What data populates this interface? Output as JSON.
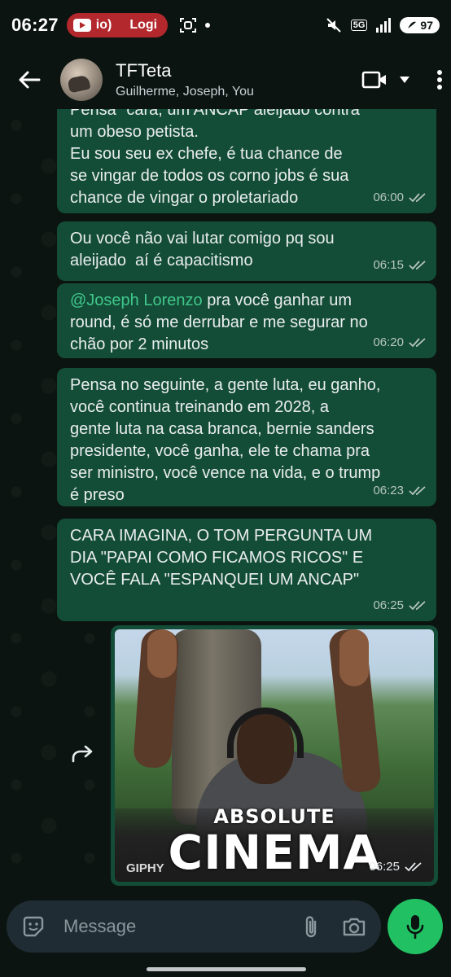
{
  "status_bar": {
    "time": "06:27",
    "media_label": "io)",
    "media_label2": "Logi",
    "network": "5G",
    "battery": "97"
  },
  "header": {
    "group_name": "TFTeta",
    "members": "Guilherme, Joseph, You"
  },
  "messages": [
    {
      "text": "Pensa \"cara, um ANCAP aleijado contra\num obeso petista.\nEu sou seu ex chefe, é tua chance de\nse vingar de todos os corno jobs é sua\nchance de vingar o proletariado",
      "time": "06:00"
    },
    {
      "text": "Ou você não vai lutar comigo pq sou\naleijado  aí é capacitismo",
      "time": "06:15"
    },
    {
      "mention": "@Joseph Lorenzo",
      "text": " pra você ganhar um\nround, é só me derrubar e me segurar no\nchão por 2 minutos",
      "time": "06:20"
    },
    {
      "text": "Pensa no seguinte, a gente luta, eu ganho,\nvocê continua treinando em 2028, a\ngente luta na casa branca, bernie sanders\npresidente, você ganha, ele te chama pra\nser ministro, você vence na vida, e o trump\né preso",
      "time": "06:23"
    },
    {
      "text": "CARA IMAGINA, O TOM PERGUNTA UM\nDIA \"PAPAI COMO FICAMOS RICOS\" E\nVOCÊ FALA \"ESPANQUEI UM ANCAP\"",
      "time": "06:25"
    }
  ],
  "gif": {
    "caption_top": "ABSOLUTE",
    "caption_main": "CINEMA",
    "source": "GIPHY",
    "time": "06:25"
  },
  "composer": {
    "placeholder": "Message"
  },
  "colors": {
    "bubble_outgoing": "#144d37",
    "mention": "#3fc78b",
    "mic": "#21c063",
    "background": "#0b1410"
  }
}
